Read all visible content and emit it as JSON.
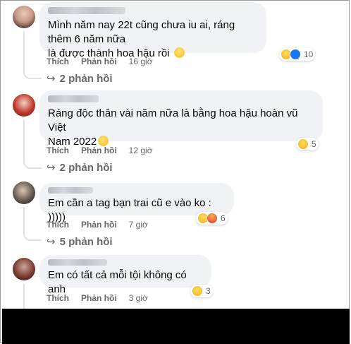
{
  "comments": [
    {
      "text_line1": "Mình năm nay 22t cũng chưa iu ai, ráng thêm 6 năm nữa",
      "text_line2": "là được thành hoa hậu rồi",
      "like_label": "Thích",
      "reply_label": "Phản hồi",
      "time": "16 giờ",
      "reaction_count": "10",
      "reaction_icons": [
        "haha-icon",
        "like-icon"
      ],
      "replies_label": "2 phản hồi"
    },
    {
      "text_line1": "Ráng độc thân vài năm nữa là bằng hoa hậu hoàn vũ Việt",
      "text_line2": "Nam 2022",
      "like_label": "Thích",
      "reply_label": "Phản hồi",
      "time": "12 giờ",
      "reaction_count": "5",
      "reaction_icons": [
        "haha-icon"
      ],
      "replies_label": "2 phản hồi"
    },
    {
      "text_line1": "Em cần a tag bạn trai cũ e vào ko : )))))",
      "like_label": "Thích",
      "reply_label": "Phản hồi",
      "time": "7 giờ",
      "reaction_count": "6",
      "reaction_icons": [
        "haha-icon",
        "angry-icon"
      ],
      "replies_label": "5 phản hồi"
    },
    {
      "text_line1": "Em có tất cả mỗi tội không có anh",
      "like_label": "Thích",
      "reply_label": "Phản hồi",
      "time": "3 giờ",
      "reaction_count": "3",
      "reaction_icons": [
        "haha-icon"
      ]
    }
  ],
  "colors": {
    "bubble": "#f0f2f5",
    "meta_text": "#65676b",
    "like_blue": "#1877f2",
    "haha_yellow": "#f7b928"
  }
}
